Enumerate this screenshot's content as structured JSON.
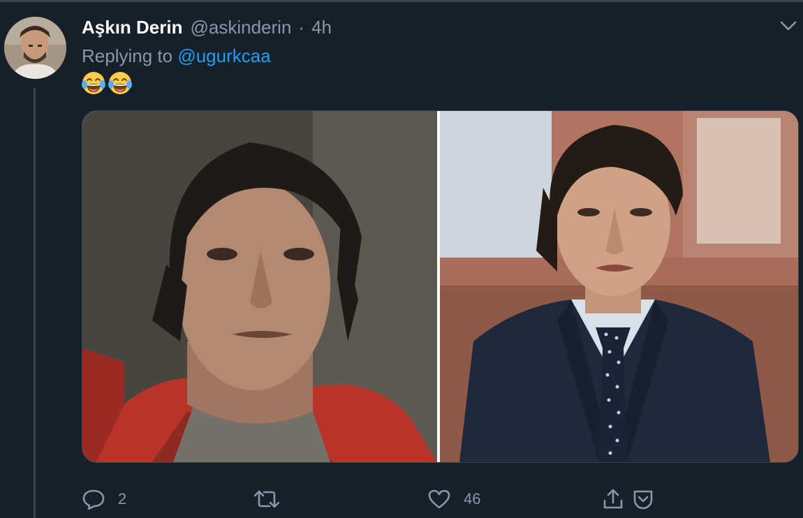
{
  "tweet": {
    "author": {
      "display_name": "Aşkın Derin",
      "handle": "@askinderin",
      "avatar": "avatar-photo"
    },
    "separator": "·",
    "time": "4h",
    "replying_to": {
      "prefix": "Replying to",
      "mention": "@ugurkcaa"
    },
    "text_emojis": [
      "face-with-tears-of-joy",
      "face-with-tears-of-joy"
    ],
    "media": {
      "type": "image",
      "panels": [
        "left-photo",
        "right-photo"
      ]
    },
    "actions": {
      "reply": {
        "icon": "reply-icon",
        "count": "2"
      },
      "retweet": {
        "icon": "retweet-icon",
        "count": ""
      },
      "like": {
        "icon": "heart-icon",
        "count": "46"
      },
      "share": {
        "icon": "share-icon"
      },
      "save": {
        "icon": "bookmark-icon"
      }
    },
    "menu_icon": "chevron-down-icon"
  },
  "colors": {
    "background": "#15202b",
    "divider": "#38444d",
    "secondary_text": "#8899a6",
    "link": "#1da1f2",
    "primary_text": "#ffffff"
  }
}
